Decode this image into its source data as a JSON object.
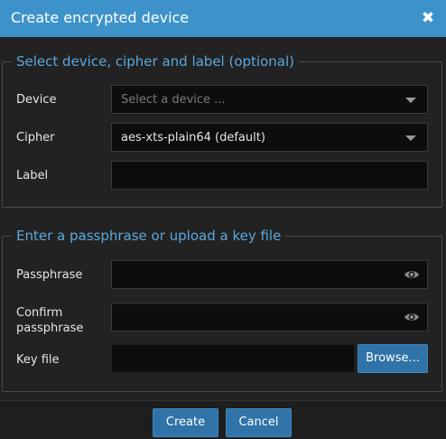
{
  "dialog": {
    "title": "Create encrypted device",
    "close_glyph": "✖"
  },
  "section_device": {
    "legend": "Select device, cipher and label (optional)",
    "device_label": "Device",
    "device_placeholder": "Select a device ...",
    "cipher_label": "Cipher",
    "cipher_value": "aes-xts-plain64 (default)",
    "label_label": "Label",
    "label_value": ""
  },
  "section_passphrase": {
    "legend": "Enter a passphrase or upload a key file",
    "passphrase_label": "Passphrase",
    "confirm_label_line1": "Confirm",
    "confirm_label_line2": "passphrase",
    "keyfile_label": "Key file",
    "browse_label": "Browse..."
  },
  "footer": {
    "create_label": "Create",
    "cancel_label": "Cancel"
  },
  "icons": {
    "close": "close-icon",
    "dropdown": "chevron-down-icon",
    "reveal": "eye-icon"
  },
  "colors": {
    "titlebar": "#3d93c9",
    "legend": "#5aa8e0",
    "button": "#2f73a8",
    "background": "#222222",
    "input": "#0d0d0d"
  }
}
